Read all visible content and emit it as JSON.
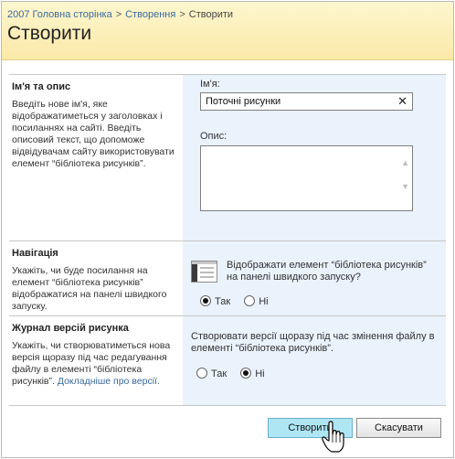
{
  "breadcrumb": {
    "items": [
      "2007 Головна сторінка",
      "Створення",
      "Створити"
    ],
    "separator": ">"
  },
  "page_title": "Створити",
  "name_section": {
    "title": "Ім'я та опис",
    "description": "Введіть нове ім'я, яке відображатиметься у заголовках і посиланнях на сайті. Введіть описовий текст, що допоможе відвідувачам сайту використовувати елемент “бібліотека рисунків”.",
    "name_label": "Ім'я:",
    "name_value": "Поточні рисунки",
    "clear_glyph": "✕",
    "description_label": "Опис:",
    "description_value": ""
  },
  "navigation_section": {
    "title": "Навігація",
    "description": "Укажіть, чи буде посилання на елемент “бібліотека рисунків” відображатися на панелі швидкого запуску.",
    "question": "Відображати елемент “бібліотека рисунків” на панелі швидкого запуску?",
    "options": [
      "Так",
      "Ні"
    ],
    "selected": "Так",
    "icon": "quick-launch-icon"
  },
  "versioning_section": {
    "title": "Журнал версій рисунка",
    "description": "Укажіть, чи створюватиметься нова версія щоразу під час редагування файлу в елементі “бібліотека рисунків”.",
    "link_text": "Докладніше про версії.",
    "question": "Створювати версії щоразу під час змінення файлу в елементі “бібліотека рисунків”.",
    "options": [
      "Так",
      "Ні"
    ],
    "selected": "Ні"
  },
  "buttons": {
    "create": "Створити",
    "cancel": "Скасувати"
  },
  "colors": {
    "header_bg": "#fbe9a8",
    "section_right_bg": "#eaf2fb",
    "link": "#3b6aa0",
    "create_button_bg": "#aee6f4"
  }
}
